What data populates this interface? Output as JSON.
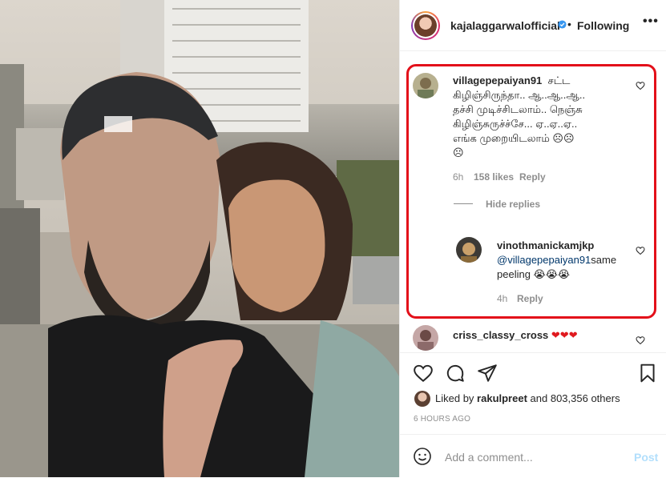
{
  "header": {
    "username": "kajalaggarwalofficial",
    "separator": "•",
    "follow_label": "Following",
    "more_label": "•••"
  },
  "comments": [
    {
      "username": "villagepepaiyan91",
      "text_lines": [
        "சட்ட",
        "கிழிஞ்சிருந்தா.. ஆ..ஆ..ஆ..",
        "தச்சி முடிச்சிடலாம்.. நெஞ்சு",
        "கிழிஞ்சுருச்ச்சே... ஏ..ஏ..ஏ..",
        "எங்க முறையிடலாம் ☹☹",
        "☹"
      ],
      "time": "6h",
      "likes": "158 likes",
      "reply_label": "Reply",
      "hide_replies_label": "Hide replies"
    },
    {
      "username": "vinothmanickamjkp",
      "mention": "@villagepepaiyan91",
      "text_rest": "same",
      "text_line2": "peeling 😭😭😭",
      "time": "4h",
      "reply_label": "Reply"
    },
    {
      "username": "criss_classy_cross",
      "text": "❤❤❤"
    }
  ],
  "likes_section": {
    "liked_by_prefix": "Liked by",
    "liked_by_user": "rakulpreet",
    "liked_by_suffix": "and 803,356 others",
    "time_ago": "6 HOURS AGO"
  },
  "add_comment": {
    "placeholder": "Add a comment...",
    "post_label": "Post"
  },
  "colors": {
    "highlight": "#e3101a",
    "link": "#00376b",
    "post_disabled": "#b2dffc",
    "verified": "#3897f0"
  }
}
